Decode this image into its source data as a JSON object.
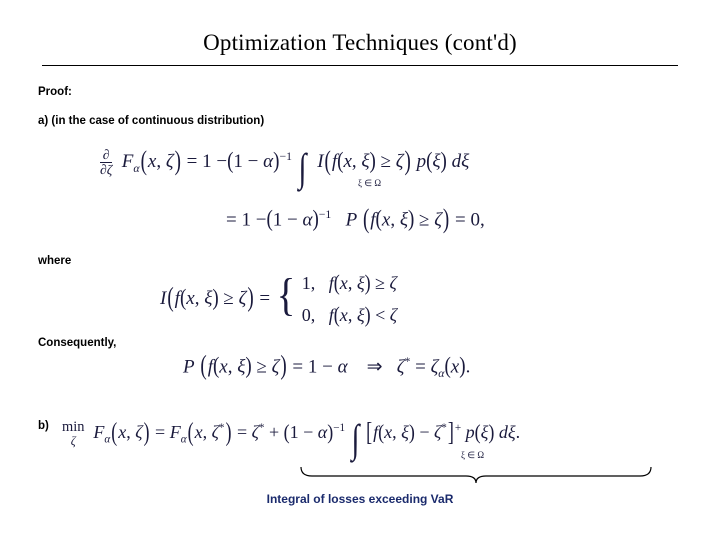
{
  "slide": {
    "title": "Optimization Techniques (cont'd)",
    "labels": {
      "proof": "Proof:",
      "case_a": "a) (in the case of continuous distribution)",
      "where": "where",
      "consequently": "Consequently,",
      "case_b": "b)"
    },
    "caption": "Integral of losses exceeding VaR",
    "equations": {
      "eq1": "∂/∂ζ Fα(x, ζ) = 1 − (1 − α)⁻¹ ∫[ξ∈Ω] I( f(x, ξ) ≥ ζ ) p(ξ) dξ",
      "eq2": "= 1 − (1 − α)⁻¹ P( f(x, ξ) ≥ ζ ) = 0,",
      "eq3": "I( f(x, ξ) ≥ ζ ) = { 1, f(x, ξ) ≥ ζ ; 0, f(x, ξ) < ζ",
      "eq4": "P( f(x, ξ) ≥ ζ ) = 1 − α  ⇒  ζ* = ζα(x).",
      "eq5": "min over ζ of Fα(x, ζ) = Fα(x, ζ*) = ζ* + (1 − α)⁻¹ ∫[ξ∈Ω] [ f(x, ξ) − ζ* ]⁺ p(ξ) dξ."
    },
    "colors": {
      "math": "#1a1a3c",
      "caption": "#1a2a6c",
      "text": "#000000"
    }
  }
}
